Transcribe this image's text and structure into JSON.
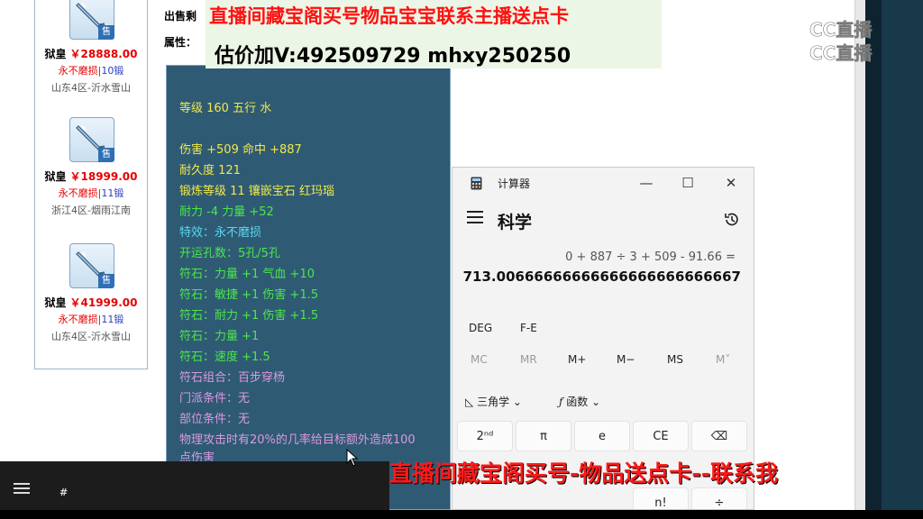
{
  "page": {
    "label_seller": "出售剩",
    "label_attr": "属性："
  },
  "listing": [
    {
      "name": "狱皇",
      "price": "￥28888.00",
      "durability": "永不磨损",
      "lock": "10锻",
      "server": "山东4区-沂水雪山"
    },
    {
      "name": "狱皇",
      "price": "￥18999.00",
      "durability": "永不磨损",
      "lock": "11锻",
      "server": "浙江4区-烟雨江南"
    },
    {
      "name": "狱皇",
      "price": "￥41999.00",
      "durability": "永不磨损",
      "lock": "11锻",
      "server": "山东4区-沂水雪山"
    }
  ],
  "sell_badge": "售",
  "banner": {
    "line1": "直播间藏宝阁买号物品宝宝联系主播送点卡",
    "line2": "估价加V:492509729    mhxy250250"
  },
  "stats": [
    {
      "text": "等级 160 五行 水",
      "color": "#f0e84a"
    },
    {
      "text": "伤害 +509 命中 +887",
      "color": "#f0e84a"
    },
    {
      "text": "耐久度 121",
      "color": "#f0e84a"
    },
    {
      "text": "锻炼等级 11 镶嵌宝石 红玛瑙",
      "color": "#f0e84a"
    },
    {
      "text": "耐力 -4 力量 +52",
      "color": "#4ae84a"
    },
    {
      "text": "特效：永不磨损",
      "color": "#5ad8f0"
    },
    {
      "text": "开运孔数：5孔/5孔",
      "color": "#4ae84a"
    },
    {
      "text": "符石：力量 +1 气血 +10",
      "color": "#4ae84a"
    },
    {
      "text": "符石：敏捷 +1 伤害 +1.5",
      "color": "#4ae84a"
    },
    {
      "text": "符石：耐力 +1 伤害 +1.5",
      "color": "#4ae84a"
    },
    {
      "text": "符石：力量 +1",
      "color": "#4ae84a"
    },
    {
      "text": "符石：速度 +1.5",
      "color": "#4ae84a"
    },
    {
      "text": "符石组合：百步穿杨",
      "color": "#d89ae0"
    },
    {
      "text": "门派条件：无",
      "color": "#d89ae0"
    },
    {
      "text": "部位条件：无",
      "color": "#d89ae0"
    },
    {
      "text": "物理攻击时有20%的几率给目标额外造成100",
      "color": "#d89ae0"
    },
    {
      "text": "点伤害",
      "color": "#d89ae0"
    }
  ],
  "logo": {
    "text1": "CC直播",
    "text2": "CC直播"
  },
  "calculator": {
    "title": "计算器",
    "mode": "科学",
    "expression": "0 + 887 ÷ 3 + 509 - 91.66 =",
    "result": "713.00666666666666666666666667",
    "deg": "DEG",
    "fe": "F-E",
    "memory": [
      "MC",
      "MR",
      "M+",
      "M−",
      "MS",
      "M˅"
    ],
    "trig": "三角学",
    "func": "函数",
    "keys": [
      "2ⁿᵈ",
      "π",
      "e",
      "CE",
      "⌫"
    ],
    "keys2": [
      "n!",
      "÷"
    ]
  },
  "taskbar": {
    "hash": "#"
  },
  "overlay_bottom": "直播间藏宝阁买号-物品送点卡--联系我"
}
